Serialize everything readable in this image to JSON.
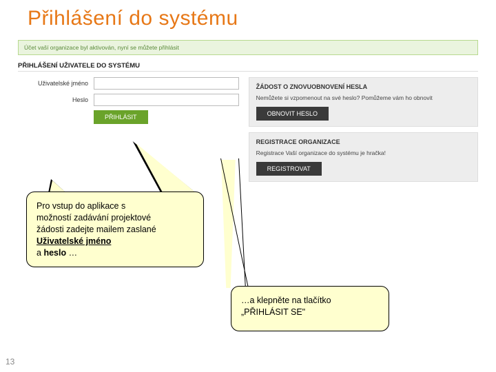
{
  "slide": {
    "title": "Přihlášení do systému",
    "page_number": "13"
  },
  "alert": {
    "text": "Účet vaší organizace byl aktivován, nyní se můžete přihlásit"
  },
  "login": {
    "heading": "PŘIHLÁŠENÍ UŽIVATELE DO SYSTÉMU",
    "username_label": "Uživatelské jméno",
    "password_label": "Heslo",
    "submit": "PŘIHLÁSIT"
  },
  "reset": {
    "heading": "ŽÁDOST O ZNOVUOBNOVENÍ HESLA",
    "text": "Nemůžete si vzpomenout na své heslo? Pomůžeme vám ho obnovit",
    "button": "OBNOVIT HESLO"
  },
  "register": {
    "heading": "REGISTRACE ORGANIZACE",
    "text": "Registrace Vaší organizace do systému je hračka!",
    "button": "REGISTROVAT"
  },
  "callout1": {
    "line1": "Pro vstup do aplikace s",
    "line2": "možností zadávání projektové",
    "line3": "žádosti zadejte mailem zaslané",
    "line4_bold": "Uživatelské jméno",
    "line5_prefix": "a ",
    "line5_bold": "heslo",
    "line5_suffix": " …"
  },
  "callout2": {
    "line1": "…a klepněte na tlačítko",
    "line2": "„PŘIHLÁSIT SE\""
  }
}
